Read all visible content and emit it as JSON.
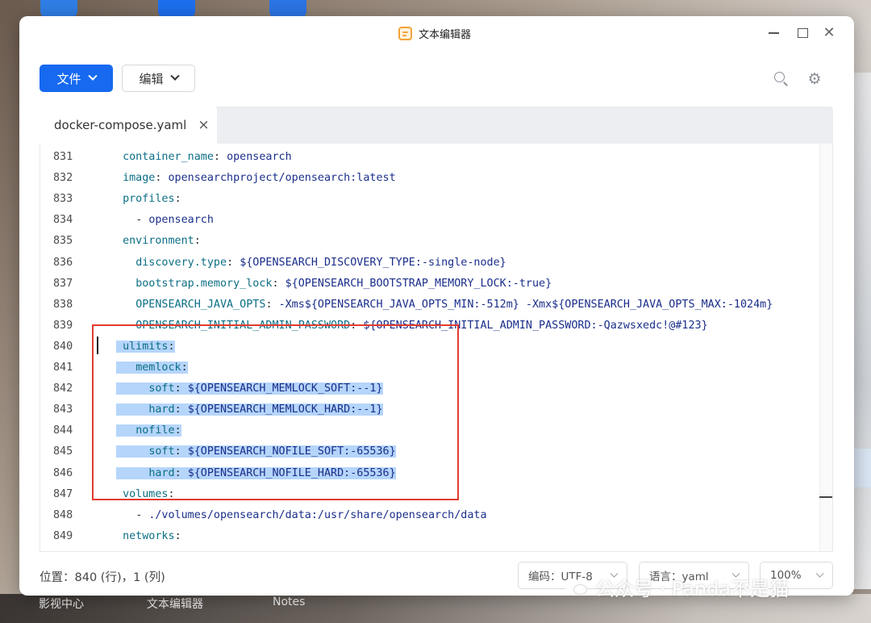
{
  "desktop": {
    "taskbar_items": [
      "影视中心",
      "文本编辑器",
      "Notes"
    ]
  },
  "window": {
    "title": "文本编辑器",
    "app_icon": "notepad-icon",
    "controls": {
      "minimize_icon": "minimize-icon",
      "maximize_icon": "maximize-icon",
      "close_icon": "close-icon"
    }
  },
  "toolbar": {
    "file_label": "文件",
    "edit_label": "编辑",
    "search_icon": "search-icon",
    "settings_icon": "gear-icon"
  },
  "tabs": [
    {
      "label": "docker-compose.yaml",
      "close": "×",
      "active": true
    }
  ],
  "editor": {
    "lines": [
      {
        "num": "831",
        "key": "    container_name",
        "sep": ": ",
        "val": "opensearch",
        "selected": false
      },
      {
        "num": "832",
        "key": "    image",
        "sep": ": ",
        "val": "opensearchproject/opensearch:latest",
        "selected": false
      },
      {
        "num": "833",
        "key": "    profiles",
        "sep": ":",
        "val": "",
        "selected": false
      },
      {
        "num": "834",
        "key": "      - ",
        "sep": "",
        "val": "opensearch",
        "selected": false
      },
      {
        "num": "835",
        "key": "    environment",
        "sep": ":",
        "val": "",
        "selected": false
      },
      {
        "num": "836",
        "key": "      discovery.type",
        "sep": ": ",
        "val": "${OPENSEARCH_DISCOVERY_TYPE:-single-node}",
        "selected": false
      },
      {
        "num": "837",
        "key": "      bootstrap.memory_lock",
        "sep": ": ",
        "val": "${OPENSEARCH_BOOTSTRAP_MEMORY_LOCK:-true}",
        "selected": false
      },
      {
        "num": "838",
        "key": "      OPENSEARCH_JAVA_OPTS",
        "sep": ": ",
        "val": "-Xms${OPENSEARCH_JAVA_OPTS_MIN:-512m} -Xmx${OPENSEARCH_JAVA_OPTS_MAX:-1024m}",
        "selected": false
      },
      {
        "num": "839",
        "key": "      OPENSEARCH_INITIAL_ADMIN_PASSWORD",
        "sep": ": ",
        "val": "${OPENSEARCH_INITIAL_ADMIN_PASSWORD:-Qazwsxedc!@#123}",
        "selected": false
      },
      {
        "num": "840",
        "key": "    ulimits",
        "sep": ":",
        "val": "",
        "selected": true
      },
      {
        "num": "841",
        "key": "      memlock",
        "sep": ":",
        "val": "",
        "selected": true
      },
      {
        "num": "842",
        "key": "        soft",
        "sep": ": ",
        "val": "${OPENSEARCH_MEMLOCK_SOFT:--1}",
        "selected": true
      },
      {
        "num": "843",
        "key": "        hard",
        "sep": ": ",
        "val": "${OPENSEARCH_MEMLOCK_HARD:--1}",
        "selected": true
      },
      {
        "num": "844",
        "key": "      nofile",
        "sep": ":",
        "val": "",
        "selected": true
      },
      {
        "num": "845",
        "key": "        soft",
        "sep": ": ",
        "val": "${OPENSEARCH_NOFILE_SOFT:-65536}",
        "selected": true
      },
      {
        "num": "846",
        "key": "        hard",
        "sep": ": ",
        "val": "${OPENSEARCH_NOFILE_HARD:-65536}",
        "selected": true
      },
      {
        "num": "847",
        "key": "    volumes",
        "sep": ":",
        "val": "",
        "selected": false
      },
      {
        "num": "848",
        "key": "      - ",
        "sep": "",
        "val": "./volumes/opensearch/data:/usr/share/opensearch/data",
        "selected": false
      },
      {
        "num": "849",
        "key": "    networks",
        "sep": ":",
        "val": "",
        "selected": false
      }
    ],
    "annotation_color": "#e23b30",
    "selection_color": "#b5d5fb"
  },
  "statusbar": {
    "position": "位置：840 (行)，1 (列)",
    "encoding": "编码：UTF-8",
    "language": "语言：yaml",
    "zoom": "100%"
  },
  "watermark": {
    "icon": "wechat-icon",
    "text": "公众号 · Panda不是猫"
  },
  "colors": {
    "accent": "#1769f0",
    "key": "#0c6e86",
    "value": "#1a2e8a"
  }
}
